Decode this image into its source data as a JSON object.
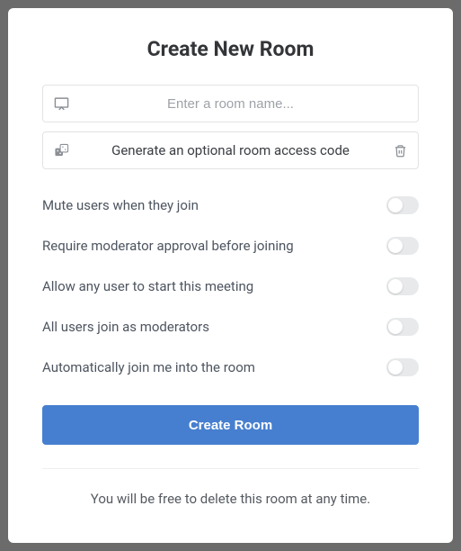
{
  "title": "Create New Room",
  "room_name": {
    "placeholder": "Enter a room name...",
    "value": ""
  },
  "access_code": {
    "label": "Generate an optional room access code"
  },
  "options": [
    {
      "label": "Mute users when they join",
      "enabled": false
    },
    {
      "label": "Require moderator approval before joining",
      "enabled": false
    },
    {
      "label": "Allow any user to start this meeting",
      "enabled": false
    },
    {
      "label": "All users join as moderators",
      "enabled": false
    },
    {
      "label": "Automatically join me into the room",
      "enabled": false
    }
  ],
  "create_button": "Create Room",
  "footer": "You will be free to delete this room at any time."
}
